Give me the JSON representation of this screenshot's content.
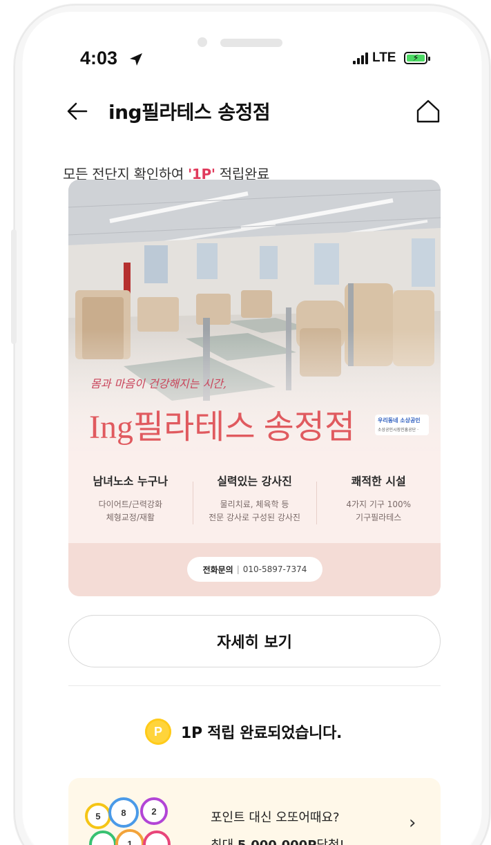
{
  "status_bar": {
    "time": "4:03",
    "network": "LTE",
    "battery_state": "charging",
    "battery_color": "#4cd964"
  },
  "header": {
    "back_icon": "arrow-left-icon",
    "title": "ing필라테스 송정점",
    "home_icon": "home-icon"
  },
  "notice": {
    "prefix": "모든 전단지 확인하여 ",
    "points": "'1P'",
    "suffix": " 적립완료",
    "accent_color": "#e03a5c"
  },
  "ad": {
    "slogan": "몸과 마음이 건강해지는 시간,",
    "brand": "Ing필라테스 송정점",
    "badge_line1": "우리동네 소상공인",
    "badge_line2": "소상공인시장진흥공단 · ",
    "features": [
      {
        "title": "남녀노소 누구나",
        "desc1": "다이어트/근력강화",
        "desc2": "체형교정/재활"
      },
      {
        "title": "실력있는 강사진",
        "desc1": "물리치료, 체육학 등",
        "desc2": "전문 강사로 구성된 강사진"
      },
      {
        "title": "쾌적한 시설",
        "desc1": "4가지 기구 100%",
        "desc2": "기구필라테스"
      }
    ],
    "contact_label": "전화문의",
    "contact_sep": "|",
    "contact_phone": "010-5897-7374",
    "brand_color": "#e05a5f"
  },
  "detail_button": "자세히 보기",
  "earned": {
    "coin_letter": "P",
    "message": "1P 적립 완료되었습니다."
  },
  "lotto": {
    "line1": "포인트 대신 오또어때요?",
    "line2_prefix": "최대 ",
    "line2_amount": "5,000,000P",
    "line2_suffix": "당첨!",
    "balls": [
      "5",
      "8",
      "2",
      "",
      "1",
      ""
    ],
    "chevron_icon": "chevron-right-icon"
  }
}
